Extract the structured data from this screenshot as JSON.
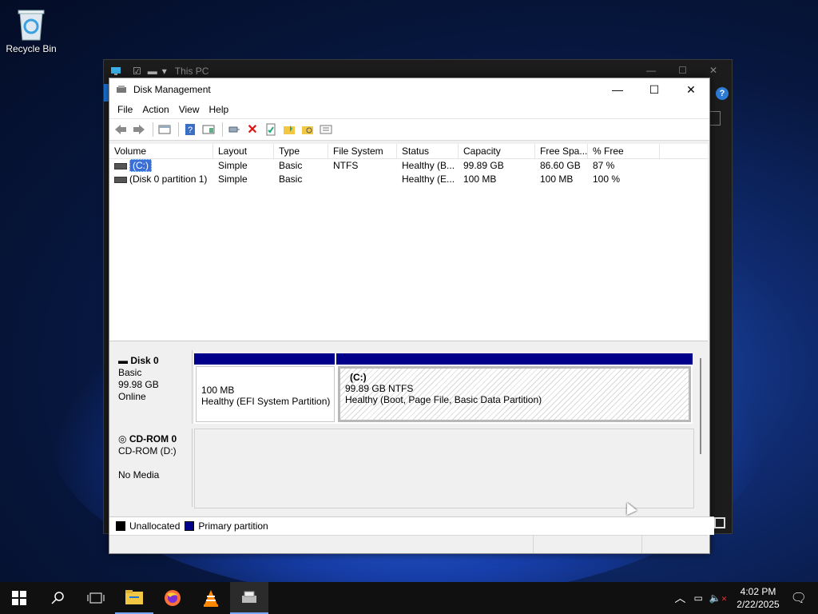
{
  "desktop": {
    "recycle_bin_label": "Recycle Bin"
  },
  "explorer": {
    "title": "This PC",
    "help": "?"
  },
  "window": {
    "title": "Disk Management"
  },
  "menu": [
    "File",
    "Action",
    "View",
    "Help"
  ],
  "columns": [
    "Volume",
    "Layout",
    "Type",
    "File System",
    "Status",
    "Capacity",
    "Free Spa...",
    "% Free"
  ],
  "volumes": [
    {
      "volume": "(C:)",
      "layout": "Simple",
      "type": "Basic",
      "fs": "NTFS",
      "status": "Healthy (B...",
      "capacity": "99.89 GB",
      "free": "86.60 GB",
      "pct": "87 %"
    },
    {
      "volume": "(Disk 0 partition 1)",
      "layout": "Simple",
      "type": "Basic",
      "fs": "",
      "status": "Healthy (E...",
      "capacity": "100 MB",
      "free": "100 MB",
      "pct": "100 %"
    }
  ],
  "disk0": {
    "name": "Disk 0",
    "type": "Basic",
    "size": "99.98 GB",
    "state": "Online",
    "part1": {
      "size": "100 MB",
      "status": "Healthy (EFI System Partition)"
    },
    "part2": {
      "name": "(C:)",
      "size": "99.89 GB NTFS",
      "status": "Healthy (Boot, Page File, Basic Data Partition)"
    }
  },
  "cdrom": {
    "name": "CD-ROM 0",
    "drive": "CD-ROM (D:)",
    "state": "No Media"
  },
  "legend": {
    "unallocated": "Unallocated",
    "primary": "Primary partition",
    "unalloc_color": "#000000",
    "primary_color": "#00008b"
  },
  "clock": {
    "time": "4:02 PM",
    "date": "2/22/2025"
  }
}
